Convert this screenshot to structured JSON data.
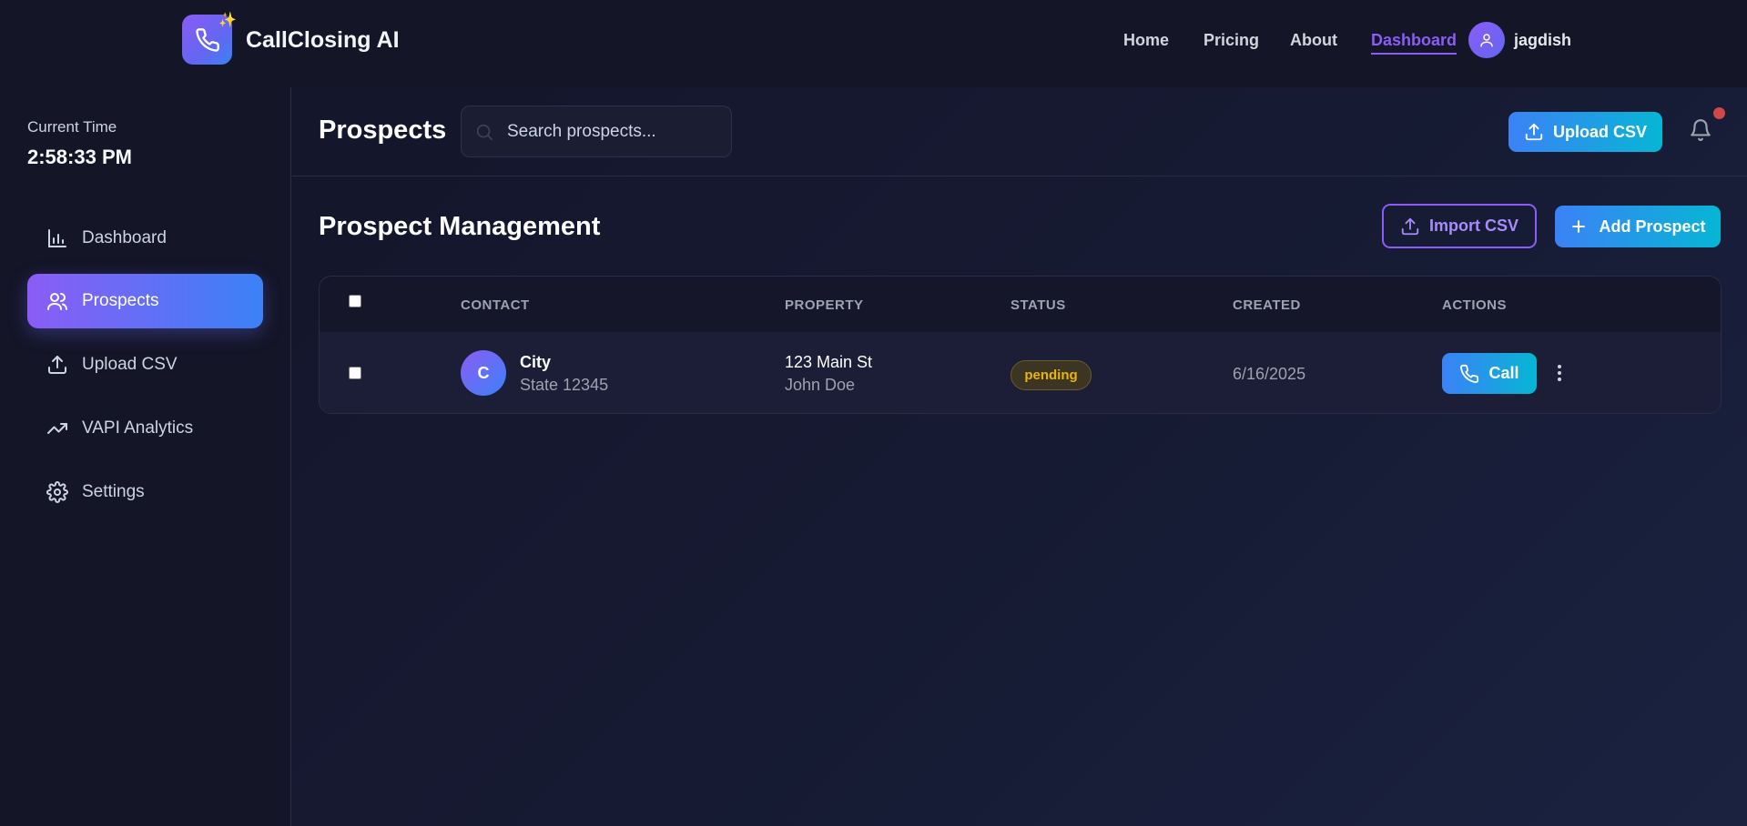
{
  "app": {
    "brand": "CallClosing AI",
    "nav": [
      "Home",
      "Pricing",
      "About",
      "Dashboard"
    ],
    "active_nav": "Dashboard",
    "user": "jagdish",
    "accent": "#8b5cf6"
  },
  "sidebar": {
    "time_label": "Current Time",
    "time_value": "2:58:33 PM",
    "items": [
      {
        "label": "Dashboard",
        "icon": "bar-chart-icon"
      },
      {
        "label": "Prospects",
        "icon": "users-icon",
        "active": true
      },
      {
        "label": "Upload CSV",
        "icon": "upload-icon"
      },
      {
        "label": "VAPI Analytics",
        "icon": "trending-up-icon"
      },
      {
        "label": "Settings",
        "icon": "gear-icon"
      }
    ]
  },
  "header": {
    "title": "Prospects",
    "search_placeholder": "Search prospects...",
    "upload_label": "Upload CSV"
  },
  "section": {
    "title": "Prospect Management",
    "import_label": "Import CSV",
    "add_label": "Add Prospect"
  },
  "table": {
    "columns": [
      "CONTACT",
      "PROPERTY",
      "STATUS",
      "CREATED",
      "ACTIONS"
    ],
    "rows": [
      {
        "avatar": "C",
        "contact_name": "City",
        "contact_sub": "State 12345",
        "property_address": "123 Main St",
        "property_owner": "John Doe",
        "status": "pending",
        "created": "6/16/2025",
        "action_label": "Call"
      }
    ]
  }
}
